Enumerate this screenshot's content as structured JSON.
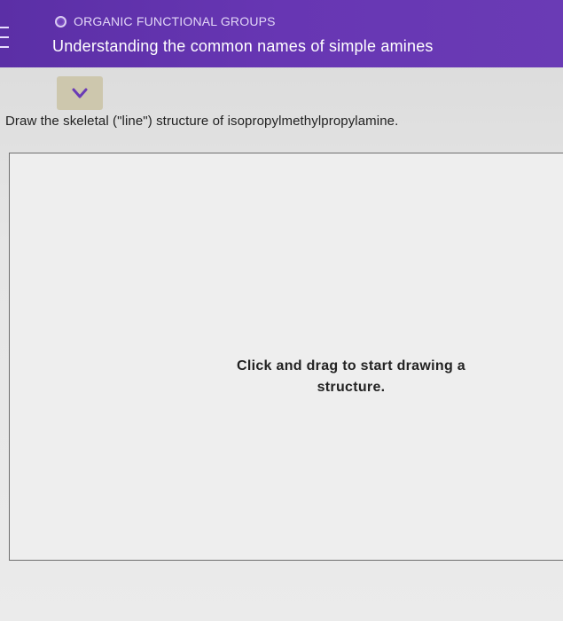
{
  "header": {
    "topic": "ORGANIC FUNCTIONAL GROUPS",
    "title": "Understanding the common names of simple amines"
  },
  "icons": {
    "menu": "menu-icon",
    "topic_status": "progress-circle-icon",
    "collapse": "chevron-down-icon"
  },
  "question": {
    "text": "Draw the skeletal (\"line\") structure of isopropylmethylpropylamine."
  },
  "drawing_area": {
    "hint_line1": "Click and drag to start drawing a",
    "hint_line2": "structure."
  },
  "colors": {
    "header_bg": "#6736b3",
    "tab_bg": "#cdc7ad",
    "chevron": "#6a3bb5"
  }
}
